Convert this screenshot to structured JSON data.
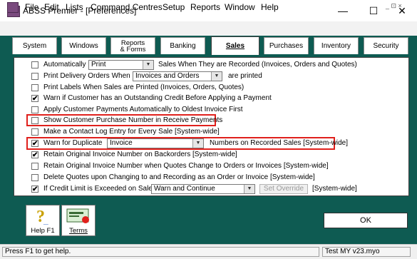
{
  "window": {
    "title": "ABSS Premier - [Preferences]",
    "minimize_glyph": "—",
    "maximize_glyph": "☐",
    "close_glyph": "✕"
  },
  "menu": {
    "items": [
      "File",
      "Edit",
      "Lists",
      "Command Centres",
      "Setup",
      "Reports",
      "Window",
      "Help"
    ],
    "mdi_controls": "_ ⊡ ×"
  },
  "tabs": [
    {
      "label": "System"
    },
    {
      "label": "Windows"
    },
    {
      "label_line1": "Reports",
      "label_line2": "& Forms"
    },
    {
      "label": "Banking"
    },
    {
      "label": "Sales",
      "active": true
    },
    {
      "label": "Purchases"
    },
    {
      "label": "Inventory"
    },
    {
      "label": "Security"
    }
  ],
  "sales_prefs": {
    "auto_record": {
      "label_pre": "Automatically",
      "select_value": "Print",
      "label_post": "Sales When They are Recorded (Invoices, Orders and Quotes)",
      "checked": false
    },
    "print_delivery": {
      "label_pre": "Print Delivery Orders When",
      "select_value": "Invoices and Orders",
      "label_post": "are printed",
      "checked": false
    },
    "print_labels": {
      "label": "Print Labels When Sales are Printed (Invoices, Orders, Quotes)",
      "checked": false
    },
    "warn_credit": {
      "label": "Warn if Customer has an Outstanding Credit Before Applying a Payment",
      "checked": true
    },
    "apply_payments": {
      "label": "Apply Customer Payments Automatically to Oldest Invoice First",
      "checked": false
    },
    "show_po_number": {
      "label": "Show Customer Purchase Number in Receive Payments",
      "checked": false
    },
    "contact_log": {
      "label": "Make a Contact Log Entry for Every Sale [System-wide]",
      "checked": false
    },
    "warn_duplicate": {
      "label_pre": "Warn for Duplicate",
      "select_value": "Invoice",
      "label_post": "Numbers on Recorded Sales [System-wide]",
      "checked": true
    },
    "retain_invoice_backorders": {
      "label": "Retain Original Invoice Number on Backorders [System-wide]",
      "checked": true
    },
    "retain_invoice_quotes": {
      "label": "Retain Original Invoice Number when Quotes Change to Orders or Invoices [System-wide]",
      "checked": false
    },
    "delete_quotes": {
      "label": "Delete Quotes upon Changing to and Recording as an Order or Invoice [System-wide]",
      "checked": false
    },
    "credit_limit": {
      "label_pre": "If Credit Limit is Exceeded on Sale",
      "select_value": "Warn and Continue",
      "override_label": "Set Override",
      "label_post": "[System-wide]",
      "checked": true
    }
  },
  "bottom": {
    "help_label": "Help F1",
    "terms_label": "Terms",
    "ok_label": "OK"
  },
  "status": {
    "hint": "Press F1 to get help.",
    "file": "Test MY v23.myo"
  },
  "colors": {
    "frame": "#0e5b52",
    "highlight": "#e0201c"
  }
}
